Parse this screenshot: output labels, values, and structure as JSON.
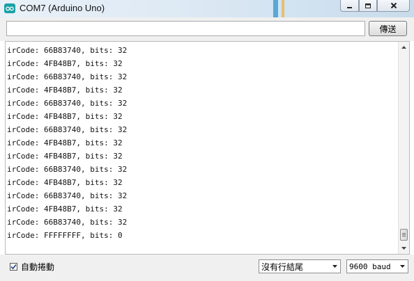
{
  "window": {
    "title": "COM7 (Arduino Uno)",
    "icon": "arduino-infinity-icon",
    "controls": [
      "minimize-icon",
      "maximize-icon",
      "close-icon"
    ]
  },
  "toolbar": {
    "input_value": "",
    "send_label": "傳送"
  },
  "output": {
    "lines": [
      "irCode: 66B83740, bits: 32",
      "irCode: 4FB48B7, bits: 32",
      "irCode: 66B83740, bits: 32",
      "irCode: 4FB48B7, bits: 32",
      "irCode: 66B83740, bits: 32",
      "irCode: 4FB48B7, bits: 32",
      "irCode: 66B83740, bits: 32",
      "irCode: 4FB48B7, bits: 32",
      "irCode: 4FB48B7, bits: 32",
      "irCode: 66B83740, bits: 32",
      "irCode: 4FB48B7, bits: 32",
      "irCode: 66B83740, bits: 32",
      "irCode: 4FB48B7, bits: 32",
      "irCode: 66B83740, bits: 32",
      "irCode: FFFFFFFF, bits: 0"
    ]
  },
  "statusbar": {
    "autoscroll_label": "自動捲動",
    "autoscroll_checked": true,
    "line_ending": "沒有行結尾",
    "baud_rate": "9600 baud"
  },
  "colors": {
    "app_icon": "#17a1a5",
    "titlebar": "#dde9f4",
    "panel": "#f0f0f0"
  }
}
